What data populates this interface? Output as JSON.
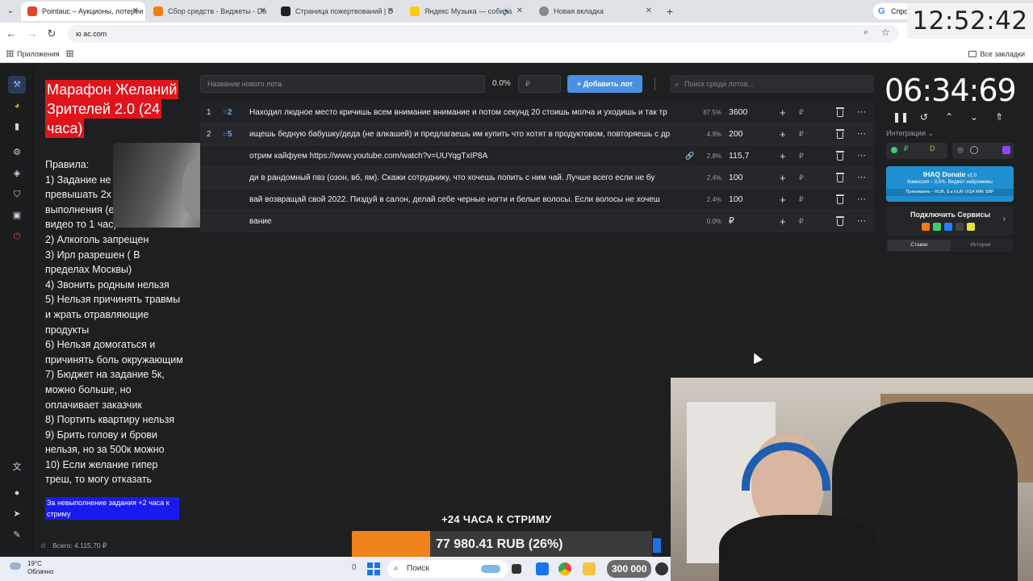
{
  "browser": {
    "tabs": [
      {
        "title": "Pointauc – Аукционы, лотереи",
        "active": true,
        "color": "#e0442a"
      },
      {
        "title": "Сбор средств - Виджеты - Do",
        "active": false,
        "color": "#f57d07"
      },
      {
        "title": "Страница пожертвований | D",
        "active": false,
        "color": "#222222"
      },
      {
        "title": "Яндекс Музыка — собира",
        "active": false,
        "color": "#ffcc00"
      },
      {
        "title": "Новая вкладка",
        "active": false,
        "color": "#888888"
      }
    ],
    "new_tab": "+",
    "ask_chip": "Спрос",
    "url": "ю   ас.com",
    "bookmarks": {
      "apps": "Приложения",
      "all": "Все закладки"
    }
  },
  "stream_clock": "12:52:42",
  "stream_panel": {
    "title_lines": [
      "Марафон Желаний",
      "Зрителей 2.0 (24",
      "часа)"
    ],
    "rules": [
      "Правила:",
      "1) Задание не д",
      "превышать 2х",
      "выполнения (е",
      "видео то 1 час)",
      "2) Алкоголь запрещен",
      "3) Ирл разрешен ( В",
      "пределах Москвы)",
      "4) Звонить родным нельзя",
      "5) Нельзя причинять травмы",
      "и жрать отравляющие",
      "продукты",
      "6) Нельзя домогаться и",
      "причинять боль окружающим",
      "7) Бюджет на задание 5к,",
      "можно больше, но",
      "оплачивает заказчик",
      "8) Портить квартиру нельзя",
      "9) Брить голову и брови",
      "нельзя, но за 500к можно",
      "10) Если желание гипер",
      "треш, то могу отказать"
    ],
    "penalty": "За невыполнение задания +2 часа к стриму",
    "total": "Всего: 4.115,70 ₽"
  },
  "add_lot": {
    "placeholder": "Название нового лота",
    "percent": "0.0%",
    "amount_placeholder": "₽",
    "button": "Добавить лот",
    "search_placeholder": "Поиск среди лотов..."
  },
  "lots": [
    {
      "num": "1",
      "fav": "2",
      "name": "Находил людное место кричишь всем внимание внимание и потом секунд 20 стоишь молча и уходишь и так тр",
      "pct": "87.5%",
      "amount": "3600",
      "link": false
    },
    {
      "num": "2",
      "fav": "5",
      "name": "ищешь бедную бабушку/деда (не алкашей) и предлагаешь им купить что хотят в продуктовом, повторяешь с др",
      "pct": "4.9%",
      "amount": "200",
      "link": false
    },
    {
      "num": "",
      "fav": "",
      "name": "отрим кайфуем  https://www.youtube.com/watch?v=UUYqgTxIP8A",
      "pct": "2.8%",
      "amount": "115,7",
      "link": true
    },
    {
      "num": "",
      "fav": "",
      "name": "ди в рандомный пвз (озон, вб, ям). Скажи сотруднику, что хочешь попить с ним чай. Лучше всего если не бу",
      "pct": "2.4%",
      "amount": "100",
      "link": false
    },
    {
      "num": "",
      "fav": "",
      "name": "вай возвращай свой 2022. Пиздуй в салон, делай себе черные ногти и белые волосы. Если волосы не хочеш",
      "pct": "2.4%",
      "amount": "100",
      "link": false
    },
    {
      "num": "",
      "fav": "",
      "name": "вание",
      "pct": "0.0%",
      "amount": "₽",
      "link": false
    }
  ],
  "right_panel": {
    "timer": "06:34:69",
    "integrations": "Интеграции ⌄",
    "donate_title": "IHAQ Donate",
    "donate_version": "v2.0",
    "donate_sub": "Комиссия – 3,5%. Виджет нейромемы",
    "donate_accept": "Принимаем – RUB, $ и EUR  VISA  MIR  SBP",
    "services": "Подключить Сервисы",
    "tabs": [
      "Ставки",
      "История"
    ]
  },
  "goal": {
    "title": "+24 ЧАСА К СТРИМУ",
    "text": "77 980.41 RUB (26%)",
    "fraction": 0.26
  },
  "taskbar": {
    "temp": "19°C",
    "weather": "Облачно",
    "zero": "0",
    "search": "Поиск",
    "badge": "300 000"
  },
  "colors": {
    "accent": "#4a90e2",
    "title_red": "#e1141c",
    "penalty_blue": "#1a1af0",
    "goal_orange": "#f0821b"
  }
}
